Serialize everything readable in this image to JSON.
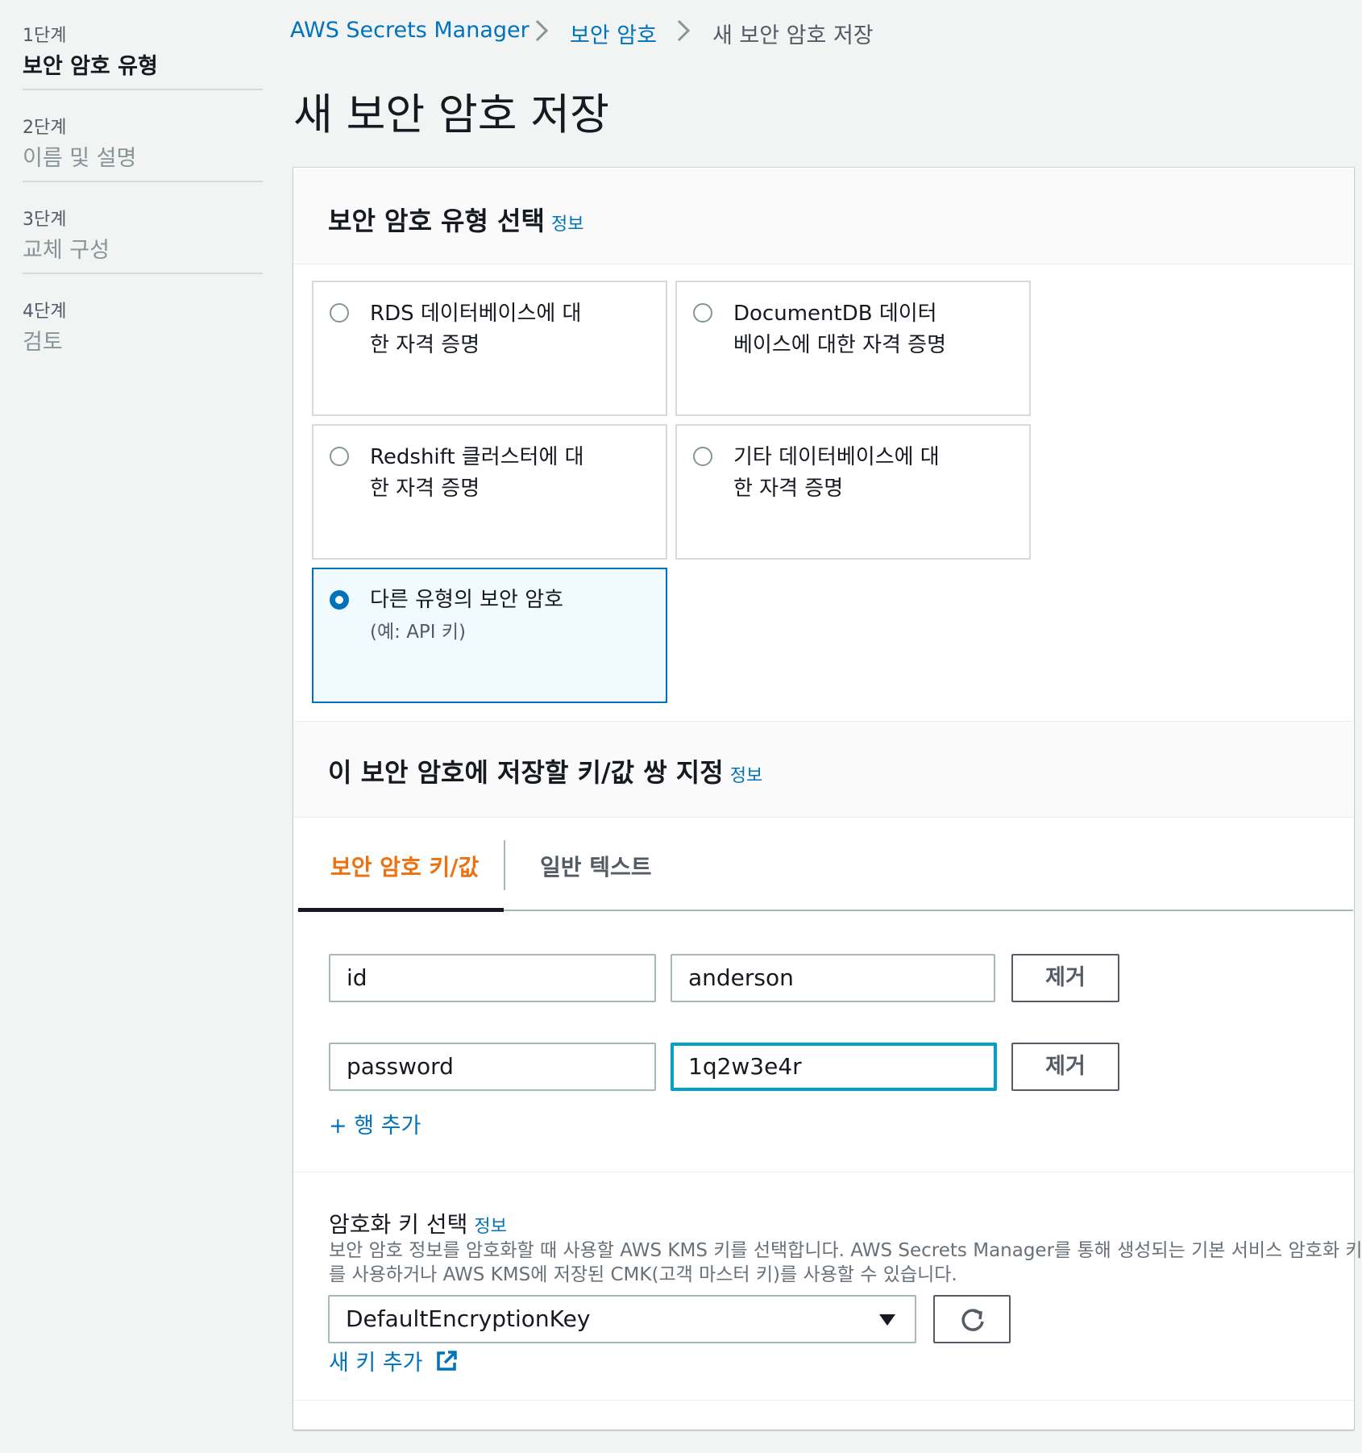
{
  "steps": [
    {
      "num": "1단계",
      "title": "보안 암호 유형"
    },
    {
      "num": "2단계",
      "title": "이름 및 설명"
    },
    {
      "num": "3단계",
      "title": "교체 구성"
    },
    {
      "num": "4단계",
      "title": "검토"
    }
  ],
  "breadcrumb": {
    "items": [
      "AWS Secrets Manager",
      "보안 암호",
      "새 보안 암호 저장"
    ]
  },
  "page_title": "새 보안 암호 저장",
  "secret_type_section": {
    "title": "보안 암호 유형 선택",
    "info": "정보",
    "options": [
      {
        "line1": "RDS 데이터베이스에 대",
        "line2": "한 자격 증명",
        "selected": false
      },
      {
        "line1": "DocumentDB 데이터",
        "line2": "베이스에 대한 자격 증명",
        "selected": false
      },
      {
        "line1": "Redshift 클러스터에 대",
        "line2": "한 자격 증명",
        "selected": false
      },
      {
        "line1": "기타 데이터베이스에 대",
        "line2": "한 자격 증명",
        "selected": false
      },
      {
        "line1": "다른 유형의 보안 암호",
        "sub": "(예: API 키)",
        "selected": true
      }
    ]
  },
  "kv_section": {
    "title": "이 보안 암호에 저장할 키/값 쌍 지정",
    "info": "정보",
    "tabs": [
      "보안 암호 키/값",
      "일반 텍스트"
    ],
    "active_tab": "보안 암호 키/값",
    "rows": [
      {
        "key": "id",
        "value": "anderson",
        "remove": "제거"
      },
      {
        "key": "password",
        "value": "1q2w3e4r",
        "remove": "제거"
      }
    ],
    "add_row": "+ 행 추가"
  },
  "encryption": {
    "label": "암호화 키 선택",
    "info": "정보",
    "description_line1": "보안 암호 정보를 암호화할 때 사용할 AWS KMS 키를 선택합니다. AWS Secrets Manager를 통해 생성되는 기본 서비스 암호화 키",
    "description_line2": "를 사용하거나 AWS KMS에 저장된 CMK(고객 마스터 키)를 사용할 수 있습니다.",
    "selected_key": "DefaultEncryptionKey",
    "add_key_link": "새 키 추가"
  },
  "colors": {
    "link": "#0073bb",
    "active_tab": "#ec7211",
    "selected_border": "#0073bb",
    "focus": "#00a1c9"
  },
  "icons": [
    "chevron-right-icon",
    "radio-icon",
    "caret-down-icon",
    "refresh-icon",
    "external-link-icon"
  ]
}
